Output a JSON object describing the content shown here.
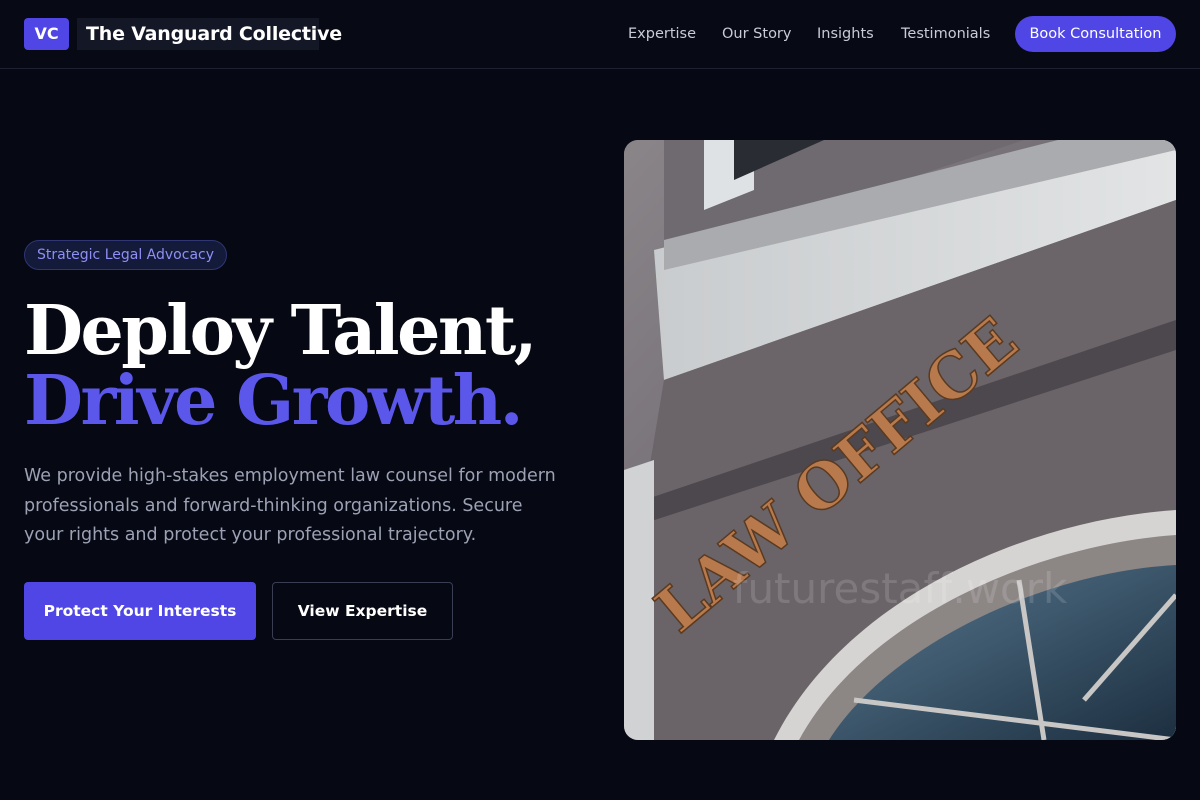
{
  "header": {
    "logo_initials": "VC",
    "brand_name": "The Vanguard Collective",
    "nav": [
      "Expertise",
      "Our Story",
      "Insights",
      "Testimonials"
    ],
    "cta_label": "Book Consultation"
  },
  "hero": {
    "badge": "Strategic Legal Advocacy",
    "headline_line1": "Deploy Talent,",
    "headline_line2": "Drive Growth.",
    "lead": "We provide high-stakes employment law counsel for modern professionals and forward-thinking organizations. Secure your rights and protect your professional trajectory.",
    "primary_button": "Protect Your Interests",
    "secondary_button": "View Expertise",
    "image": {
      "sign_text": "LAW OFFICE",
      "watermark": "futurestaff.work"
    }
  },
  "colors": {
    "background": "#060814",
    "accent": "#4f46e5",
    "headline_accent": "#5b57ea",
    "muted_text": "#9ca1b4"
  }
}
